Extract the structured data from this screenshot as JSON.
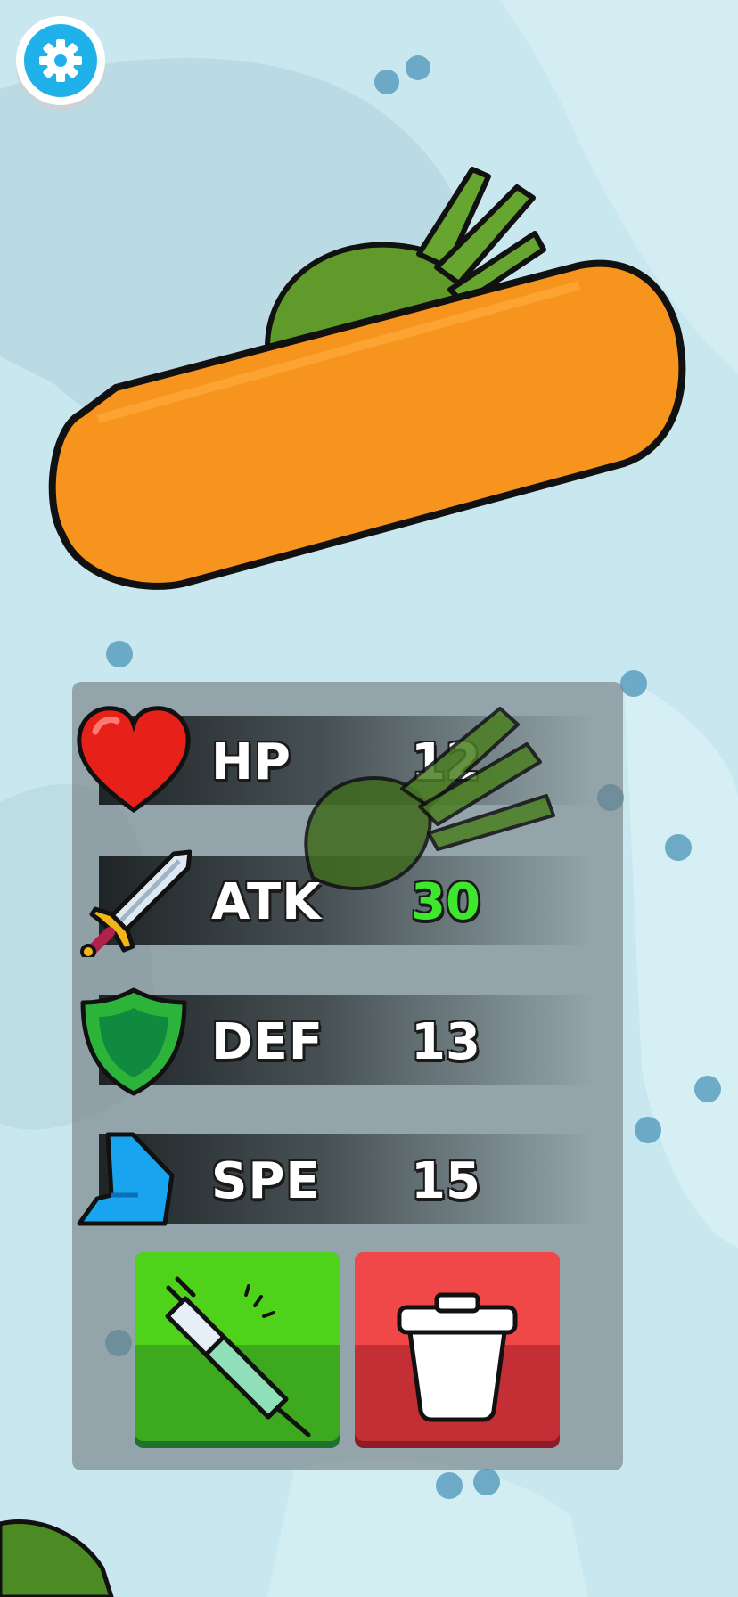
{
  "colors": {
    "background": "#c7e6ee",
    "carrot_orange": "#f7941d",
    "leaf_green": "#5f9a2a",
    "settings_blue": "#1fb2ea",
    "inject_green": "#4ed31a",
    "discard_red": "#f04848",
    "buffed_value_green": "#3ee62d"
  },
  "settings": {
    "icon": "gear-icon"
  },
  "stats": [
    {
      "key": "hp",
      "icon": "heart-icon",
      "label": "HP",
      "value": "12",
      "value_color": "#ffffff"
    },
    {
      "key": "atk",
      "icon": "sword-icon",
      "label": "ATK",
      "value": "30",
      "value_color": "#3ee62d"
    },
    {
      "key": "def",
      "icon": "shield-icon",
      "label": "DEF",
      "value": "13",
      "value_color": "#ffffff"
    },
    {
      "key": "spe",
      "icon": "boot-icon",
      "label": "SPE",
      "value": "15",
      "value_color": "#ffffff"
    }
  ],
  "actions": {
    "inject": {
      "icon": "syringe-icon"
    },
    "discard": {
      "icon": "trash-icon"
    }
  }
}
